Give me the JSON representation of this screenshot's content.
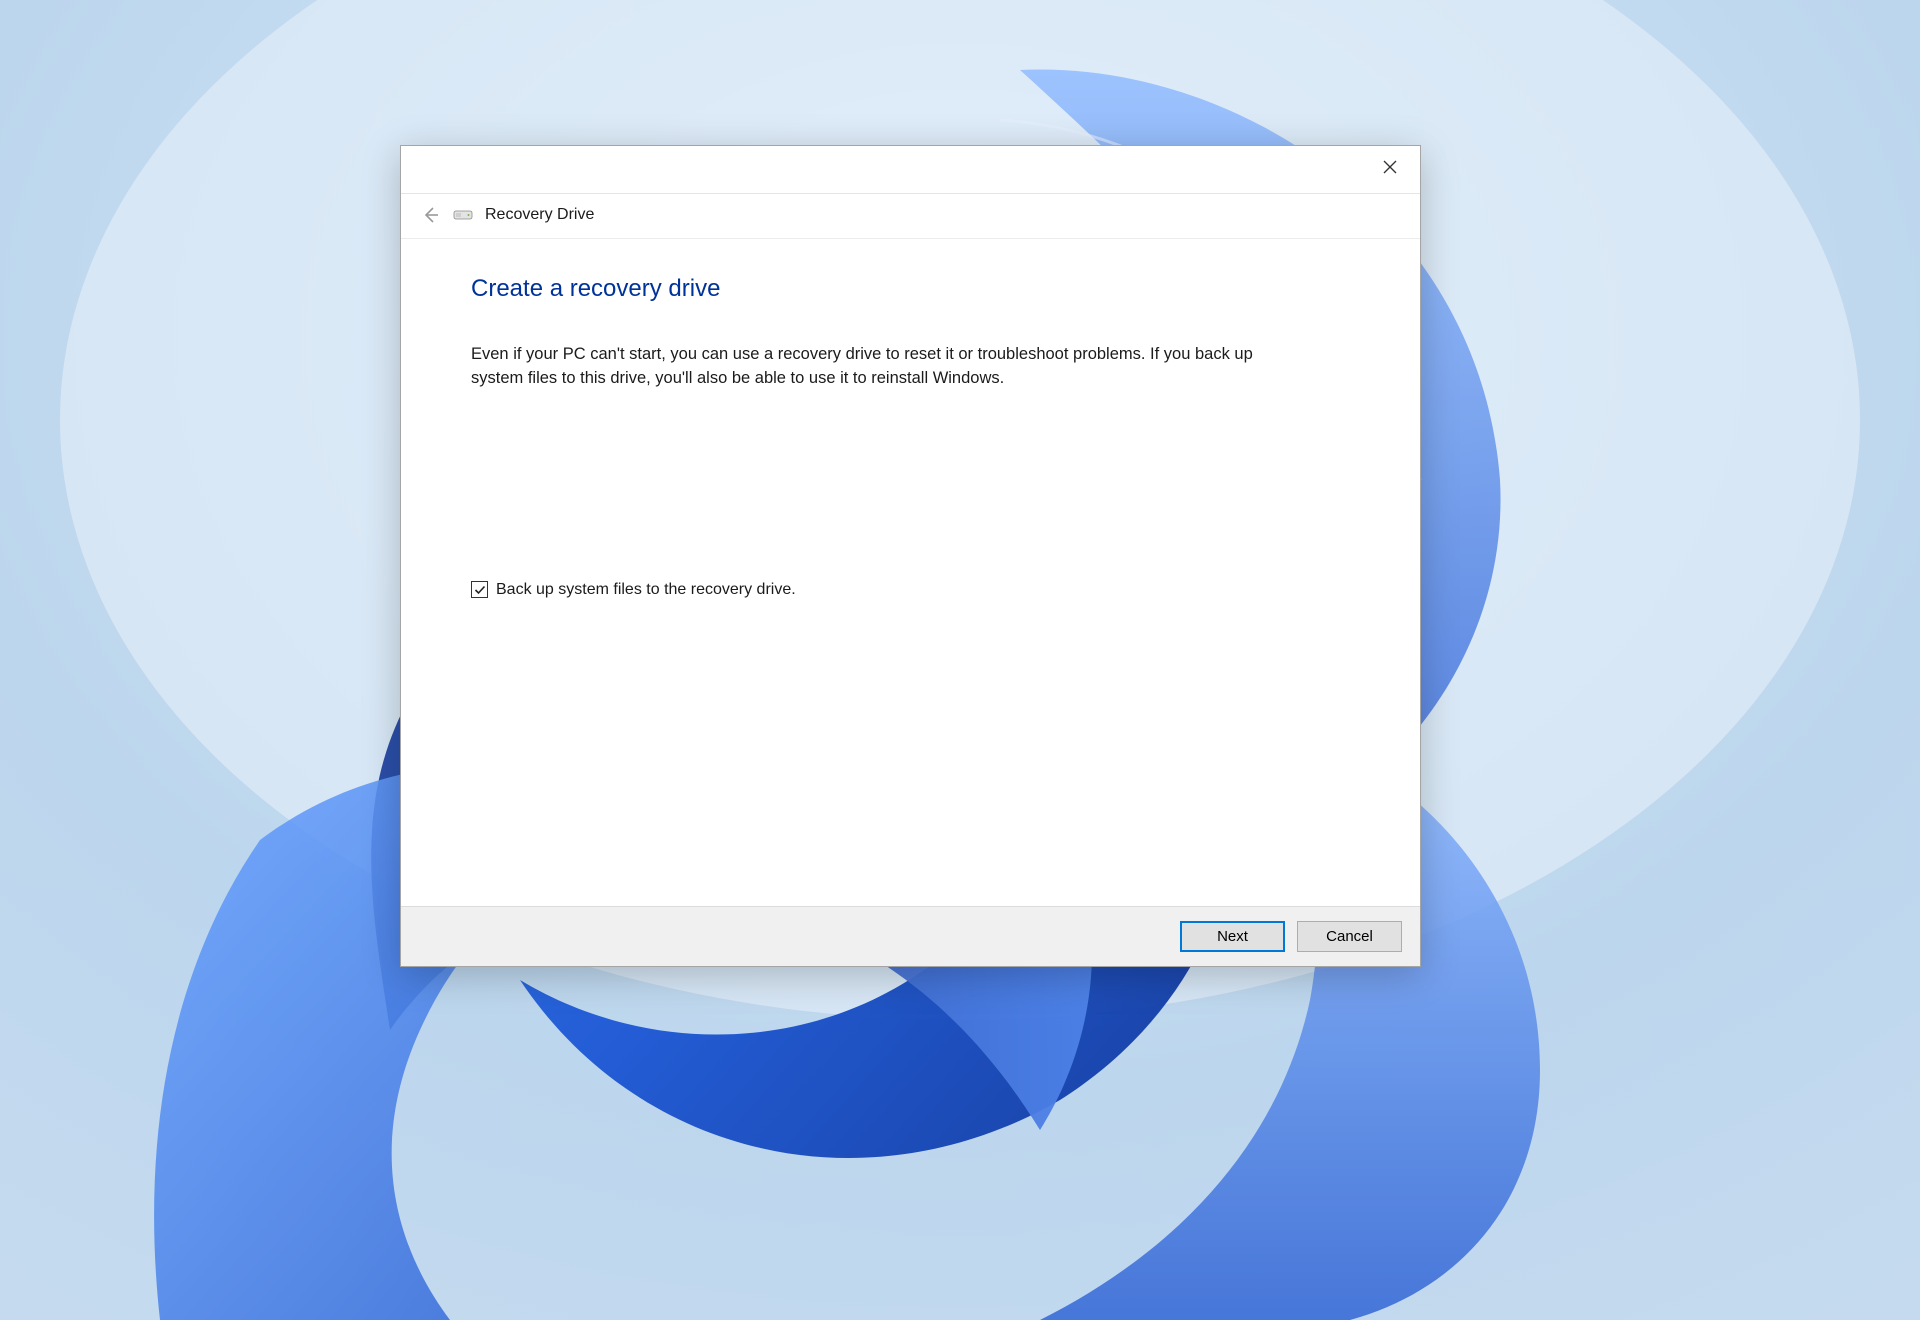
{
  "window": {
    "wizard_title": "Recovery Drive"
  },
  "content": {
    "heading": "Create a recovery drive",
    "description": "Even if your PC can't start, you can use a recovery drive to reset it or troubleshoot problems. If you back up system files to this drive, you'll also be able to use it to reinstall Windows.",
    "checkbox_label": "Back up system files to the recovery drive.",
    "checkbox_checked": true
  },
  "buttons": {
    "next": "Next",
    "cancel": "Cancel"
  },
  "colors": {
    "heading_color": "#003399",
    "primary_border": "#0078d7"
  }
}
